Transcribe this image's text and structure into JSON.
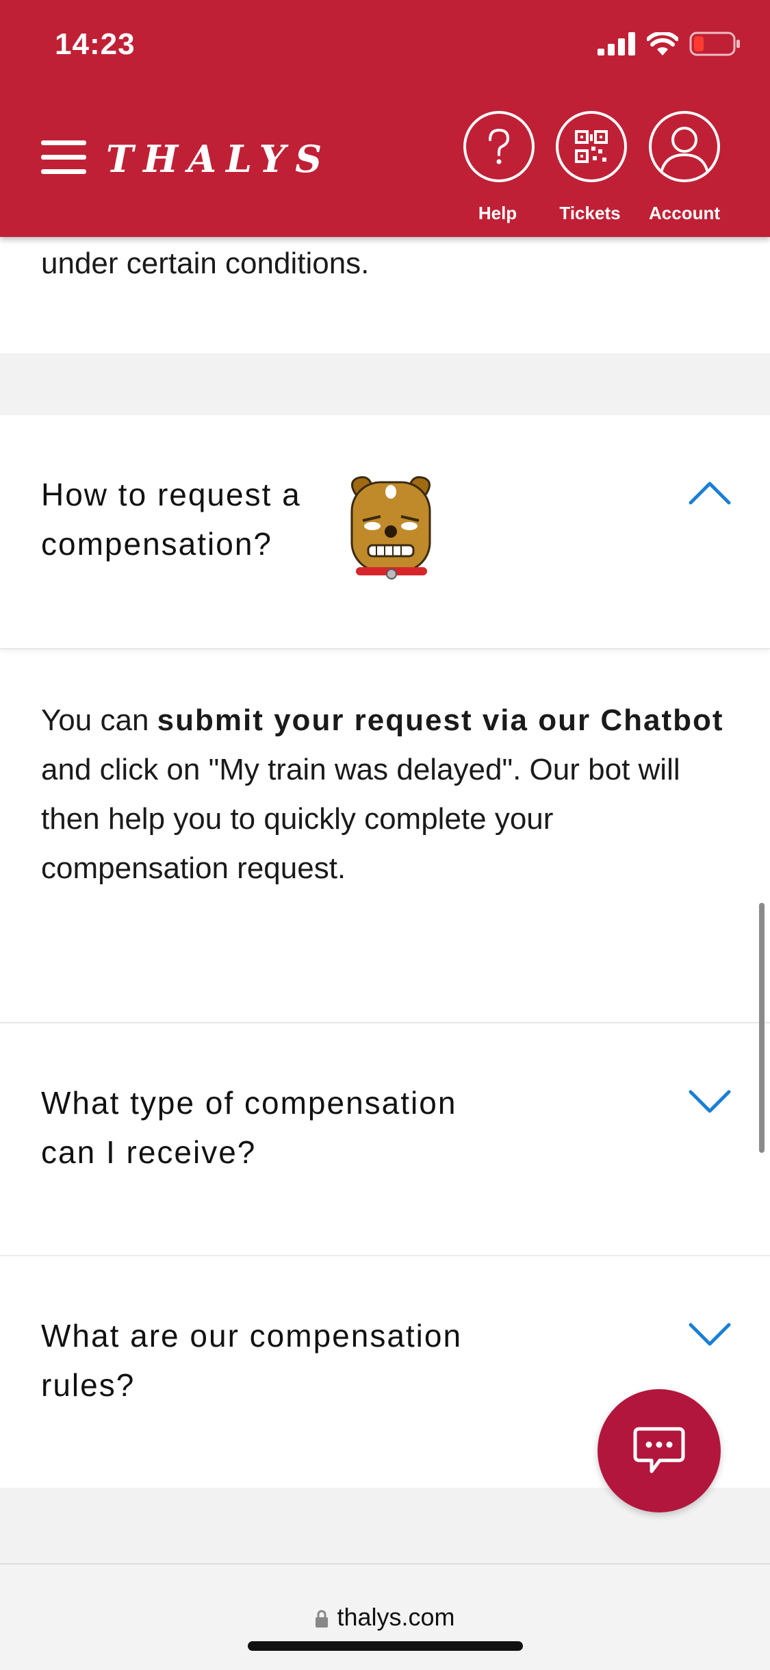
{
  "status": {
    "time": "14:23"
  },
  "header": {
    "logo": "THALYS",
    "buttons": {
      "help": "Help",
      "tickets": "Tickets",
      "account": "Account"
    }
  },
  "content": {
    "partial_text": "under certain conditions.",
    "faq1": {
      "title_line1": "How to request a",
      "title_line2": "compensation?",
      "answer": {
        "p1_normal": "You can ",
        "p1_bold": "submit your request via our Chatbot",
        "p1_rest": " and click on \"My train was delayed\". Our bot will then help you to quickly complete your compensation request."
      }
    },
    "faq2": {
      "title_line1": "What type of compensation",
      "title_line2": "can I receive?"
    },
    "faq3": {
      "title_line1": "What are our compensation",
      "title_line2": "rules?"
    }
  },
  "browser": {
    "url": "thalys.com"
  },
  "colors": {
    "brand": "#c02035",
    "accent": "#1a7fd4",
    "chat": "#b2163c"
  },
  "icons": [
    "menu-icon",
    "help-icon",
    "qr-code-icon",
    "account-icon",
    "chevron-up-icon",
    "chevron-down-icon",
    "chat-icon",
    "lock-icon",
    "dog-sticker-icon"
  ]
}
